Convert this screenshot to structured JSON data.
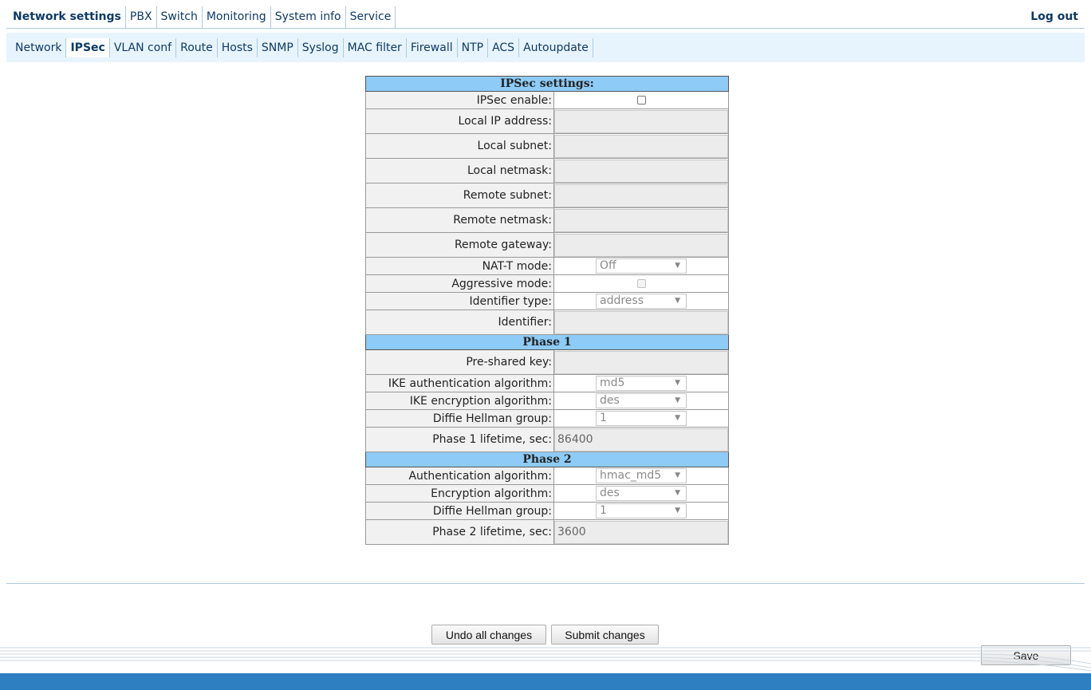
{
  "topnav": {
    "tabs": [
      {
        "label": "Network settings",
        "active": true
      },
      {
        "label": "PBX",
        "active": false
      },
      {
        "label": "Switch",
        "active": false
      },
      {
        "label": "Monitoring",
        "active": false
      },
      {
        "label": "System info",
        "active": false
      },
      {
        "label": "Service",
        "active": false
      }
    ],
    "logout": "Log out"
  },
  "subnav": {
    "tabs": [
      {
        "label": "Network",
        "active": false
      },
      {
        "label": "IPSec",
        "active": true
      },
      {
        "label": "VLAN conf",
        "active": false
      },
      {
        "label": "Route",
        "active": false
      },
      {
        "label": "Hosts",
        "active": false
      },
      {
        "label": "SNMP",
        "active": false
      },
      {
        "label": "Syslog",
        "active": false
      },
      {
        "label": "MAC filter",
        "active": false
      },
      {
        "label": "Firewall",
        "active": false
      },
      {
        "label": "NTP",
        "active": false
      },
      {
        "label": "ACS",
        "active": false
      },
      {
        "label": "Autoupdate",
        "active": false
      }
    ]
  },
  "settings": {
    "rows": [
      {
        "kind": "header",
        "label": "IPSec settings:"
      },
      {
        "kind": "checkbox",
        "label": "IPSec enable:",
        "checked": false,
        "disabled": false
      },
      {
        "kind": "text",
        "label": "Local IP address:",
        "value": ""
      },
      {
        "kind": "text",
        "label": "Local subnet:",
        "value": ""
      },
      {
        "kind": "text",
        "label": "Local netmask:",
        "value": ""
      },
      {
        "kind": "text",
        "label": "Remote subnet:",
        "value": ""
      },
      {
        "kind": "text",
        "label": "Remote netmask:",
        "value": ""
      },
      {
        "kind": "text",
        "label": "Remote gateway:",
        "value": ""
      },
      {
        "kind": "select",
        "label": "NAT-T mode:",
        "value": "Off"
      },
      {
        "kind": "checkbox",
        "label": "Aggressive mode:",
        "checked": false,
        "disabled": true
      },
      {
        "kind": "select",
        "label": "Identifier type:",
        "value": "address"
      },
      {
        "kind": "text",
        "label": "Identifier:",
        "value": ""
      },
      {
        "kind": "header",
        "label": "Phase 1"
      },
      {
        "kind": "text",
        "label": "Pre-shared key:",
        "value": ""
      },
      {
        "kind": "select",
        "label": "IKE authentication algorithm:",
        "value": "md5"
      },
      {
        "kind": "select",
        "label": "IKE encryption algorithm:",
        "value": "des"
      },
      {
        "kind": "select",
        "label": "Diffie Hellman group:",
        "value": "1"
      },
      {
        "kind": "text",
        "label": "Phase 1 lifetime, sec:",
        "value": "86400"
      },
      {
        "kind": "header",
        "label": "Phase 2"
      },
      {
        "kind": "select",
        "label": "Authentication algorithm:",
        "value": "hmac_md5"
      },
      {
        "kind": "select",
        "label": "Encryption algorithm:",
        "value": "des"
      },
      {
        "kind": "select",
        "label": "Diffie Hellman group:",
        "value": "1"
      },
      {
        "kind": "text",
        "label": "Phase 2 lifetime, sec:",
        "value": "3600"
      }
    ]
  },
  "buttons": {
    "undo": "Undo all changes",
    "submit": "Submit changes",
    "save": "Save"
  },
  "colors": {
    "header_bg": "#8ecbf7",
    "nav_text": "#0d3a66",
    "subnav_bg": "#e8f4fd",
    "footer_bar": "#2e7fc2"
  }
}
